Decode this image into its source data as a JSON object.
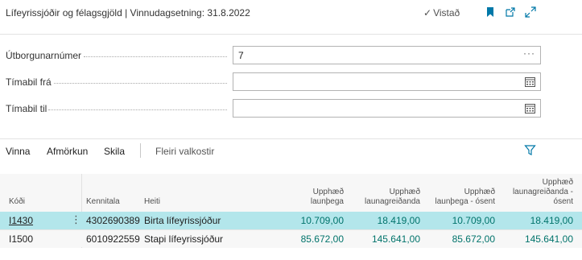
{
  "header": {
    "title": "Lífeyrissjóðir og félagsgjöld | Vinnudagsetning: 31.8.2022",
    "saved_label": "Vistað",
    "icons": [
      "bookmark-icon",
      "open-new-window-icon",
      "expand-icon"
    ],
    "accent": "#0078a8"
  },
  "fields": {
    "payout_number": {
      "label": "Útborgunarnúmer",
      "value": "7"
    },
    "period_from": {
      "label": "Tímabil frá",
      "value": ""
    },
    "period_to": {
      "label": "Tímabil til",
      "value": ""
    }
  },
  "actions": {
    "vinna": "Vinna",
    "afmorkun": "Afmörkun",
    "skila": "Skila",
    "more": "Fleiri valkostir"
  },
  "table": {
    "columns": {
      "code": "Kóði",
      "id": "Kennitala",
      "name": "Heiti",
      "wage_amount_1": "Upphæð",
      "wage_amount_2": "launþega",
      "employer_amount_1": "Upphæð",
      "employer_amount_2": "launagreiðanda",
      "wage_unsent_1": "Upphæð",
      "wage_unsent_2": "launþega - ósent",
      "employer_unsent_1": "Upphæð",
      "employer_unsent_2": "launagreiðanda -",
      "employer_unsent_3": "ósent"
    },
    "rows": [
      {
        "code": "I1430",
        "id": "4302690389",
        "name": "Birta lífeyrissjóður",
        "wage": "10.709,00",
        "employer": "18.419,00",
        "wage_unsent": "10.709,00",
        "employer_unsent": "18.419,00"
      },
      {
        "code": "I1500",
        "id": "6010922559",
        "name": "Stapi lífeyrissjóður",
        "wage": "85.672,00",
        "employer": "145.641,00",
        "wage_unsent": "85.672,00",
        "employer_unsent": "145.641,00"
      }
    ]
  }
}
